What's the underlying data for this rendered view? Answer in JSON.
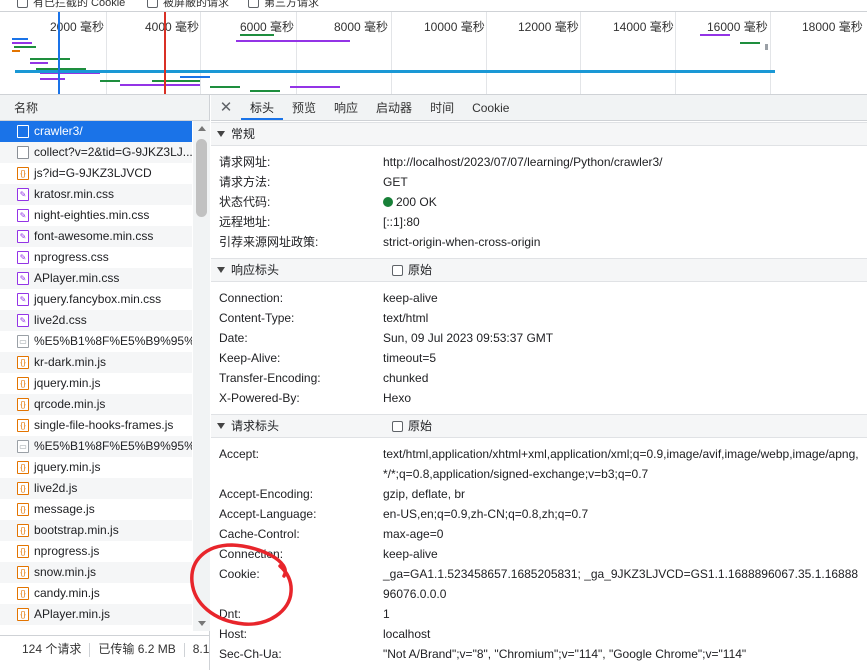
{
  "filter_strip": {
    "items": [
      "有已拦截的 Cookie",
      "被屏蔽的请求",
      "第三方请求"
    ]
  },
  "overview": {
    "tick_labels": [
      "2000 毫秒",
      "4000 毫秒",
      "6000 毫秒",
      "8000 毫秒",
      "10000 毫秒",
      "12000 毫秒",
      "14000 毫秒",
      "16000 毫秒",
      "18000 毫秒"
    ]
  },
  "request_list": {
    "header": "名称",
    "items": [
      {
        "name": "crawler3/",
        "icon": "document-icon",
        "selected": true
      },
      {
        "name": "collect?v=2&tid=G-9JKZ3LJ...",
        "icon": "blank-icon"
      },
      {
        "name": "js?id=G-9JKZ3LJVCD",
        "icon": "script-icon"
      },
      {
        "name": "kratosr.min.css",
        "icon": "stylesheet-icon"
      },
      {
        "name": "night-eighties.min.css",
        "icon": "stylesheet-icon"
      },
      {
        "name": "font-awesome.min.css",
        "icon": "stylesheet-icon"
      },
      {
        "name": "nprogress.css",
        "icon": "stylesheet-icon"
      },
      {
        "name": "APlayer.min.css",
        "icon": "stylesheet-icon"
      },
      {
        "name": "jquery.fancybox.min.css",
        "icon": "stylesheet-icon"
      },
      {
        "name": "live2d.css",
        "icon": "stylesheet-icon"
      },
      {
        "name": "%E5%B1%8F%E5%B9%95%...",
        "icon": "image-icon"
      },
      {
        "name": "kr-dark.min.js",
        "icon": "script-icon"
      },
      {
        "name": "jquery.min.js",
        "icon": "script-icon"
      },
      {
        "name": "qrcode.min.js",
        "icon": "script-icon"
      },
      {
        "name": "single-file-hooks-frames.js",
        "icon": "script-icon"
      },
      {
        "name": "%E5%B1%8F%E5%B9%95%...",
        "icon": "image-icon"
      },
      {
        "name": "jquery.min.js",
        "icon": "script-icon"
      },
      {
        "name": "live2d.js",
        "icon": "script-icon"
      },
      {
        "name": "message.js",
        "icon": "script-icon"
      },
      {
        "name": "bootstrap.min.js",
        "icon": "script-icon"
      },
      {
        "name": "nprogress.js",
        "icon": "script-icon"
      },
      {
        "name": "snow.min.js",
        "icon": "script-icon"
      },
      {
        "name": "candy.min.js",
        "icon": "script-icon"
      },
      {
        "name": "APlayer.min.js",
        "icon": "script-icon"
      }
    ],
    "status": {
      "requests": "124 个请求",
      "transferred": "已传输 6.2 MB",
      "more": "8.1"
    }
  },
  "tabs": [
    "标头",
    "预览",
    "响应",
    "启动器",
    "时间",
    "Cookie"
  ],
  "active_tab": "标头",
  "general": {
    "title": "常规",
    "rows": [
      {
        "k": "请求网址:",
        "v": "http://localhost/2023/07/07/learning/Python/crawler3/"
      },
      {
        "k": "请求方法:",
        "v": "GET"
      },
      {
        "k": "状态代码:",
        "v": "200 OK"
      },
      {
        "k": "远程地址:",
        "v": "[::1]:80"
      },
      {
        "k": "引荐来源网址政策:",
        "v": "strict-origin-when-cross-origin"
      }
    ]
  },
  "response_headers": {
    "title": "响应标头",
    "raw_label": "原始",
    "rows": [
      {
        "k": "Connection:",
        "v": "keep-alive"
      },
      {
        "k": "Content-Type:",
        "v": "text/html"
      },
      {
        "k": "Date:",
        "v": "Sun, 09 Jul 2023 09:53:37 GMT"
      },
      {
        "k": "Keep-Alive:",
        "v": "timeout=5"
      },
      {
        "k": "Transfer-Encoding:",
        "v": "chunked"
      },
      {
        "k": "X-Powered-By:",
        "v": "Hexo"
      }
    ]
  },
  "request_headers": {
    "title": "请求标头",
    "raw_label": "原始",
    "rows": [
      {
        "k": "Accept:",
        "v": "text/html,application/xhtml+xml,application/xml;q=0.9,image/avif,image/webp,image/apng,*/*;q=0.8,application/signed-exchange;v=b3;q=0.7"
      },
      {
        "k": "Accept-Encoding:",
        "v": "gzip, deflate, br"
      },
      {
        "k": "Accept-Language:",
        "v": "en-US,en;q=0.9,zh-CN;q=0.8,zh;q=0.7"
      },
      {
        "k": "Cache-Control:",
        "v": "max-age=0"
      },
      {
        "k": "Connection:",
        "v": "keep-alive"
      },
      {
        "k": "Cookie:",
        "v": "_ga=GA1.1.523458657.1685205831; _ga_9JKZ3LJVCD=GS1.1.1688896067.35.1.1688896076.0.0.0"
      },
      {
        "k": "Dnt:",
        "v": "1"
      },
      {
        "k": "Host:",
        "v": "localhost"
      },
      {
        "k": "Sec-Ch-Ua:",
        "v": "\"Not A/Brand\";v=\"8\", \"Chromium\";v=\"114\", \"Google Chrome\";v=\"114\""
      }
    ]
  },
  "colors": {
    "accent": "#1a73e8",
    "status_ok": "#188038",
    "annotation": "#e8252b"
  }
}
